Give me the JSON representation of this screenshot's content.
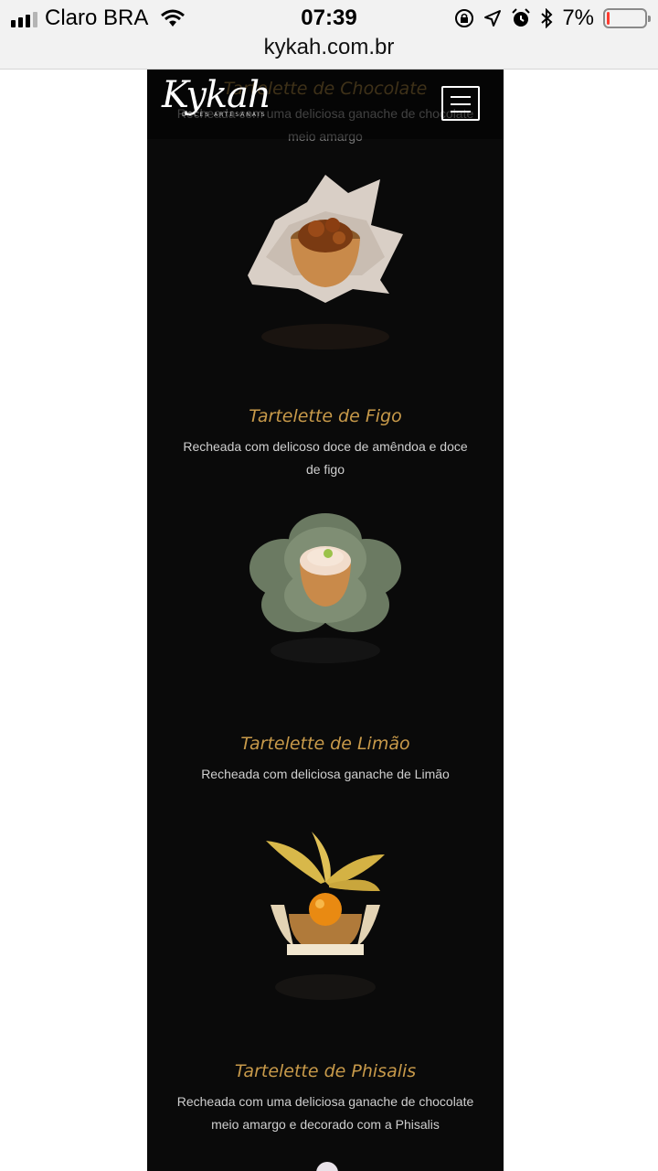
{
  "status": {
    "carrier": "Claro BRA",
    "time": "07:39",
    "battery_text": "7%",
    "battery_level": 0.07
  },
  "browser": {
    "url": "kykah.com.br"
  },
  "site": {
    "logo_text": "Kykah",
    "logo_subtitle": "DOCES ARTESANAIS"
  },
  "products": [
    {
      "title": "Tartelette de Chocolate",
      "description": "Recheada com uma deliciosa ganache de chocolate meio amargo"
    },
    {
      "title": "Tartelette de Figo",
      "description": "Recheada com delicoso doce de amêndoa e doce de figo"
    },
    {
      "title": "Tartelette de Limão",
      "description": "Recheada com deliciosa ganache de Limão"
    },
    {
      "title": "Tartelette de Phisalis",
      "description": "Recheada com uma deliciosa ganache de chocolate meio amargo e decorado com a Phisalis"
    }
  ],
  "icons": {
    "menu": "hamburger-menu-icon",
    "wifi": "wifi-icon",
    "lock": "orientation-lock-icon",
    "location": "location-arrow-icon",
    "alarm": "alarm-icon",
    "bluetooth": "bluetooth-icon"
  },
  "colors": {
    "accent": "#c89a4a",
    "background": "#0a0a0a"
  }
}
